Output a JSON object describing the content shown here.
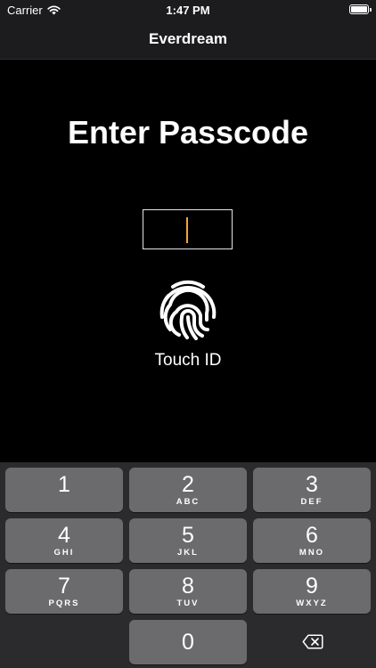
{
  "status_bar": {
    "carrier": "Carrier",
    "time": "1:47 PM",
    "wifi_icon": "wifi-icon",
    "battery_icon": "battery-icon"
  },
  "nav": {
    "title": "Everdream"
  },
  "screen": {
    "heading": "Enter Passcode",
    "passcode_value": "",
    "touch_id_label": "Touch ID",
    "touch_id_icon": "fingerprint-icon"
  },
  "keypad": {
    "keys": [
      {
        "digit": "1",
        "letters": ""
      },
      {
        "digit": "2",
        "letters": "ABC"
      },
      {
        "digit": "3",
        "letters": "DEF"
      },
      {
        "digit": "4",
        "letters": "GHI"
      },
      {
        "digit": "5",
        "letters": "JKL"
      },
      {
        "digit": "6",
        "letters": "MNO"
      },
      {
        "digit": "7",
        "letters": "PQRS"
      },
      {
        "digit": "8",
        "letters": "TUV"
      },
      {
        "digit": "9",
        "letters": "WXYZ"
      },
      {
        "digit": "0",
        "letters": ""
      }
    ],
    "delete_icon": "backspace-icon"
  },
  "colors": {
    "background": "#000000",
    "bar_background": "#1c1c1e",
    "keypad_background": "#2b2b2d",
    "key_background": "#6b6b6e",
    "cursor": "#f2a33c",
    "text": "#ffffff"
  }
}
